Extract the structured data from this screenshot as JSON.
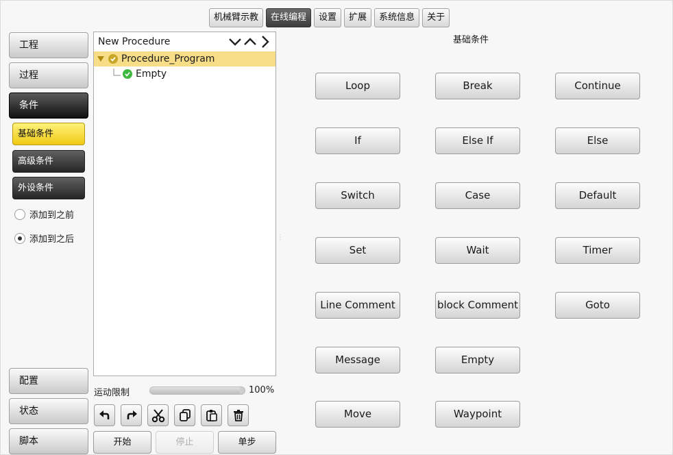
{
  "top_tabs": [
    {
      "label": "机械臂示教",
      "active": false
    },
    {
      "label": "在线编程",
      "active": true
    },
    {
      "label": "设置",
      "active": false
    },
    {
      "label": "扩展",
      "active": false
    },
    {
      "label": "系统信息",
      "active": false
    },
    {
      "label": "关于",
      "active": false
    }
  ],
  "sidebar": {
    "project": "工程",
    "process": "过程",
    "condition": "条件",
    "basic_condition": "基础条件",
    "advanced_condition": "高级条件",
    "peripheral_condition": "外设条件",
    "add_before": "添加到之前",
    "add_after": "添加到之后",
    "insert_mode": "after",
    "config": "配置",
    "status": "状态",
    "script": "脚本"
  },
  "tree": {
    "title": "New Procedure",
    "root": "Procedure_Program",
    "child": "Empty"
  },
  "motion": {
    "label": "运动限制",
    "value_text": "100%",
    "fill_fraction": 0.95
  },
  "toolbar_icons": [
    "undo-icon",
    "redo-icon",
    "cut-icon",
    "copy-icon",
    "paste-icon",
    "delete-icon"
  ],
  "run": {
    "start": "开始",
    "stop": "停止",
    "step": "单步"
  },
  "conditions": {
    "title": "基础条件",
    "loop": "Loop",
    "break": "Break",
    "continue": "Continue",
    "if": "If",
    "else_if": "Else If",
    "else": "Else",
    "switch": "Switch",
    "case": "Case",
    "default": "Default",
    "set": "Set",
    "wait": "Wait",
    "timer": "Timer",
    "line_comment": "Line Comment",
    "block_comment": "block Comment",
    "goto": "Goto",
    "message": "Message",
    "empty": "Empty",
    "move": "Move",
    "waypoint": "Waypoint"
  },
  "colors": {
    "accent_yellow": "#f0c915",
    "selected_row": "#f7dd87",
    "check_green": "#3fb83f",
    "check_gold": "#c9a728"
  }
}
